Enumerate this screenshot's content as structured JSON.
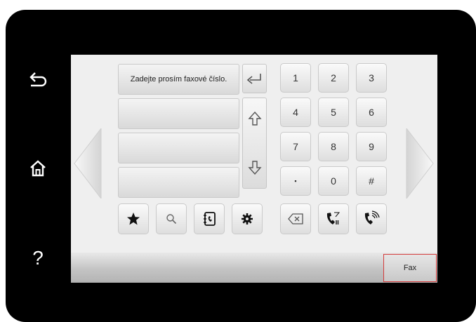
{
  "side_buttons": {
    "back_icon": "back-arrow-icon",
    "home_icon": "home-icon",
    "help_label": "?"
  },
  "fax_entry": {
    "prompt": "Zadejte prosím faxové číslo."
  },
  "keypad": {
    "keys": [
      "1",
      "2",
      "3",
      "4",
      "5",
      "6",
      "7",
      "8",
      "9",
      "▪",
      "0",
      "#"
    ]
  },
  "toolbar": {
    "icons": [
      "star-icon",
      "search-icon",
      "address-book-icon",
      "gear-icon"
    ]
  },
  "status": {
    "tab_label": "Fax"
  },
  "colors": {
    "bezel": "#000000",
    "screen": "#efefef",
    "tab_border": "#d43b3b"
  }
}
